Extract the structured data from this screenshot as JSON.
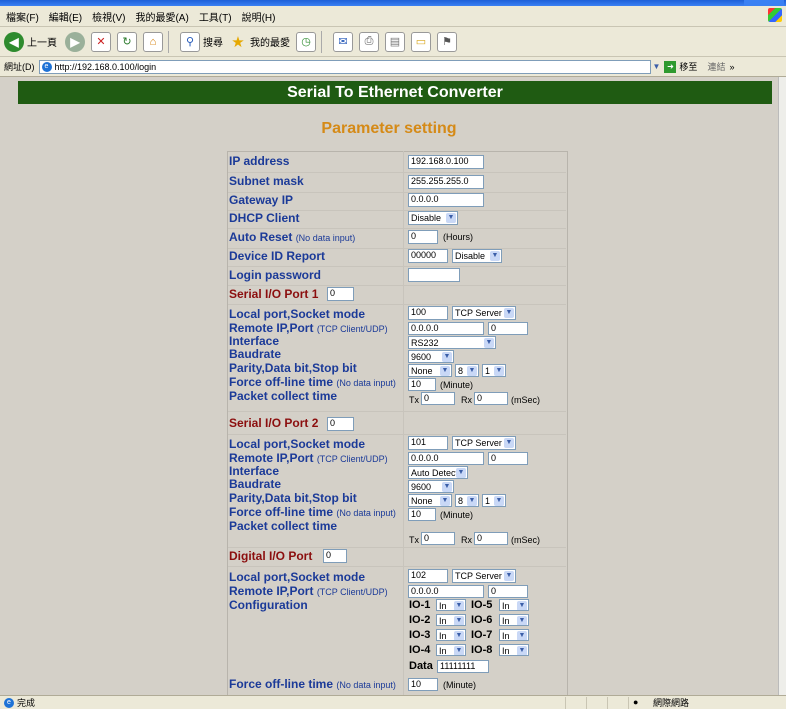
{
  "menu": [
    "檔案(F)",
    "編輯(E)",
    "檢視(V)",
    "我的最愛(A)",
    "工具(T)",
    "說明(H)"
  ],
  "toolbar": {
    "back": "上一頁",
    "search": "搜尋",
    "favorites": "我的最愛"
  },
  "address": {
    "label": "網址(D)",
    "url": "http://192.168.0.100/login",
    "go": "移至",
    "links": "連結"
  },
  "page": {
    "header": "Serial To Ethernet Converter",
    "subtitle": "Parameter setting"
  },
  "network": {
    "ip_label": "IP address",
    "ip_value": "192.168.0.100",
    "mask_label": "Subnet mask",
    "mask_value": "255.255.255.0",
    "gateway_label": "Gateway IP",
    "gateway_value": "0.0.0.0",
    "dhcp_label": "DHCP Client",
    "dhcp_value": "Disable",
    "reset_label": "Auto Reset",
    "reset_note": "(No data input)",
    "reset_value": "0",
    "reset_unit": "(Hours)",
    "devid_label": "Device ID Report",
    "devid_value": "00000",
    "devid_mode": "Disable",
    "pwd_label": "Login password",
    "pwd_value": ""
  },
  "labels": {
    "local": "Local port,Socket mode",
    "remote": "Remote IP,Port",
    "remote_note": "(TCP Client/UDP)",
    "interface": "Interface",
    "baud": "Baudrate",
    "parity": "Parity,Data bit,Stop bit",
    "forceoff": "Force off-line time",
    "forceoff_note": "(No data input)",
    "packet": "Packet collect time",
    "configuration": "Configuration",
    "minute": "(Minute)",
    "msec": "(mSec)",
    "tx": "Tx",
    "rx": "Rx",
    "data": "Data"
  },
  "port1": {
    "title": "Serial I/O Port 1",
    "num": "0",
    "local_port": "100",
    "socket_mode": "TCP Server",
    "remote_ip": "0.0.0.0",
    "remote_port": "0",
    "interface": "RS232",
    "baud": "9600",
    "parity": "None",
    "databits": "8",
    "stopbits": "1",
    "forceoff": "10",
    "tx": "0",
    "rx": "0"
  },
  "port2": {
    "title": "Serial I/O Port 2",
    "num": "0",
    "local_port": "101",
    "socket_mode": "TCP Server",
    "remote_ip": "0.0.0.0",
    "remote_port": "0",
    "interface": "Auto Detect",
    "baud": "9600",
    "parity": "None",
    "databits": "8",
    "stopbits": "1",
    "forceoff": "10",
    "tx": "0",
    "rx": "0"
  },
  "digital": {
    "title": "Digital I/O Port",
    "num": "0",
    "local_port": "102",
    "socket_mode": "TCP Server",
    "remote_ip": "0.0.0.0",
    "remote_port": "0",
    "data": "11111111",
    "forceoff": "10",
    "io": [
      {
        "name": "IO-1",
        "value": "In"
      },
      {
        "name": "IO-5",
        "value": "In"
      },
      {
        "name": "IO-2",
        "value": "In"
      },
      {
        "name": "IO-6",
        "value": "In"
      },
      {
        "name": "IO-3",
        "value": "In"
      },
      {
        "name": "IO-7",
        "value": "In"
      },
      {
        "name": "IO-4",
        "value": "In"
      },
      {
        "name": "IO-8",
        "value": "In"
      }
    ]
  },
  "status": {
    "left": "完成",
    "zone": "網際網路"
  }
}
